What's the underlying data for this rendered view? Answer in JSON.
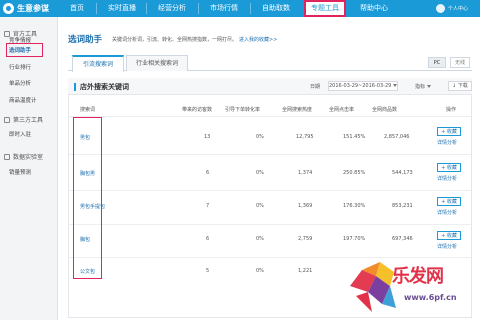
{
  "topbar": {
    "logo": "生意参谋",
    "nav": [
      "首页",
      "实时直播",
      "经营分析",
      "市场行情",
      "自助取数",
      "专题工具",
      "帮助中心"
    ],
    "active_nav": "专题工具",
    "user": "个人中心"
  },
  "sidebar": {
    "sections": [
      {
        "label": "官方工具",
        "items": [
          "竞争情报",
          "选词助手",
          "行业排行",
          "单品分析",
          "商品温度计"
        ]
      },
      {
        "label": "第三方工具",
        "items": [
          "即时入驻"
        ]
      },
      {
        "label": "数据实验室",
        "items": [
          "销量预测"
        ]
      }
    ],
    "active_item": "选词助手"
  },
  "page": {
    "title": "选词助手",
    "desc": "关键词分析词，引流、转化、全网热搜指数，一网打尽。",
    "link": "进入我的收藏>>"
  },
  "tabs": [
    "引流搜索词",
    "行业相关搜索词"
  ],
  "toggles": {
    "pc": "PC",
    "wireless": "无线"
  },
  "card": {
    "title": "店外搜索关键词",
    "date_label": "日期",
    "date_range": "2016-03-29~2016-03-29",
    "metric_label": "指标",
    "download": "下载"
  },
  "table": {
    "headers": [
      "搜索词",
      "带来的访客数",
      "引导下单转化率",
      "全网搜索热度",
      "全网点击率",
      "全网商品数",
      "操作"
    ],
    "rows": [
      {
        "kw": "男包",
        "visitors": "13",
        "conv": "0%",
        "heat": "12,795",
        "ctr": "151.45%",
        "goods": "2,857,046"
      },
      {
        "kw": "胸包男",
        "visitors": "6",
        "conv": "0%",
        "heat": "1,374",
        "ctr": "250.85%",
        "goods": "544,173"
      },
      {
        "kw": "男包手提包",
        "visitors": "7",
        "conv": "0%",
        "heat": "1,369",
        "ctr": "176.30%",
        "goods": "853,231"
      },
      {
        "kw": "胸包",
        "visitors": "6",
        "conv": "0%",
        "heat": "2,759",
        "ctr": "197.70%",
        "goods": "697,346"
      },
      {
        "kw": "公文包",
        "visitors": "5",
        "conv": "0%",
        "heat": "1,221",
        "ctr": "",
        "goods": ""
      }
    ],
    "action_button": "+ 收藏",
    "action_link": "详情分析"
  },
  "watermark": {
    "text": "乐发网",
    "url": "www.6pf.cn"
  },
  "colors": {
    "brand": "#1b9ad8",
    "highlight": "#e0245e",
    "link": "#1b6fb0"
  }
}
